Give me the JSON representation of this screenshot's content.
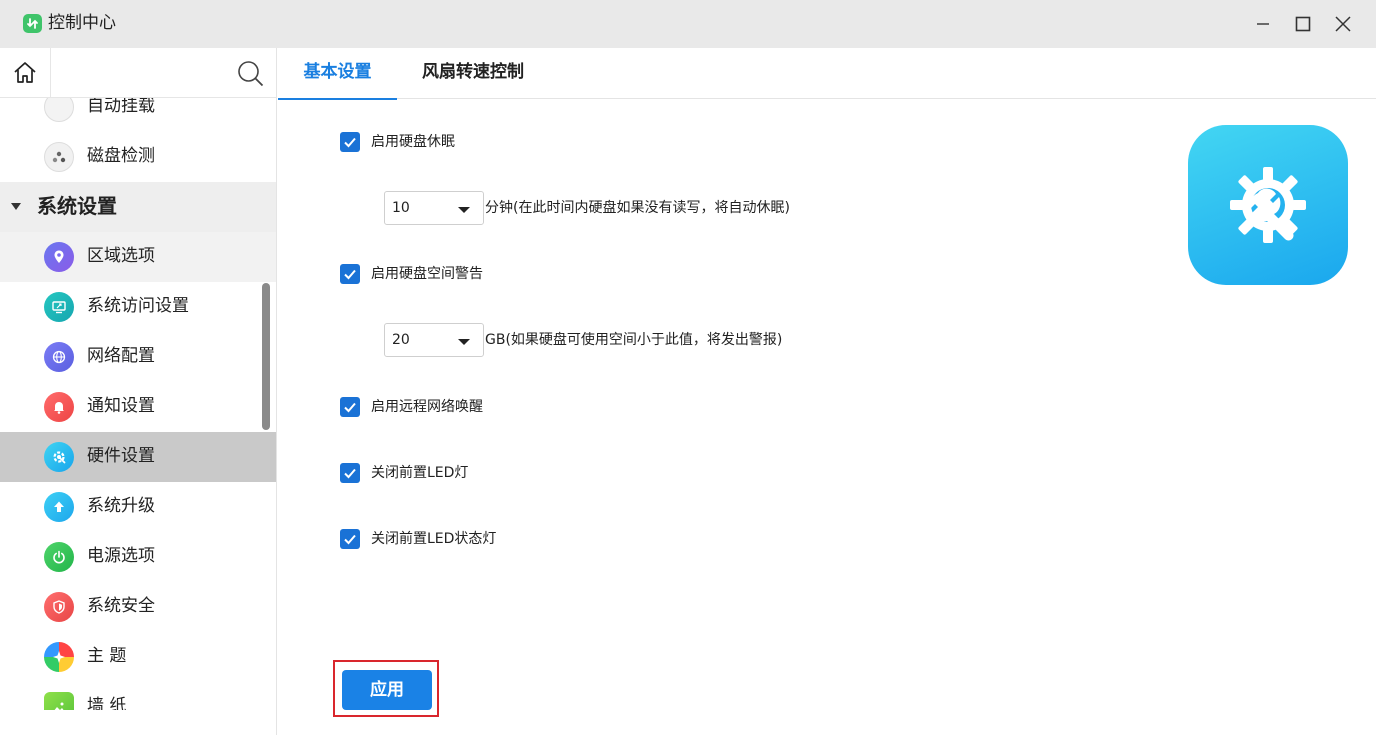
{
  "window": {
    "title": "控制中心"
  },
  "colors": {
    "accent": "#1a7fe0",
    "apply_highlight": "#d9262d",
    "active_item_bg": "#c9c9c9"
  },
  "sidebar": {
    "partial_top_item": "自动挂载",
    "disk_check": "磁盘检测",
    "group": "系统设置",
    "items": [
      {
        "label": "区域选项",
        "icon": "location-pin-icon"
      },
      {
        "label": "系统访问设置",
        "icon": "monitor-access-icon"
      },
      {
        "label": "网络配置",
        "icon": "network-globe-icon"
      },
      {
        "label": "通知设置",
        "icon": "bell-icon"
      },
      {
        "label": "硬件设置",
        "icon": "hardware-gear-icon"
      },
      {
        "label": "系统升级",
        "icon": "upgrade-arrow-icon"
      },
      {
        "label": "电源选项",
        "icon": "power-icon"
      },
      {
        "label": "系统安全",
        "icon": "shield-icon"
      },
      {
        "label": "主 题",
        "icon": "theme-pinwheel-icon"
      },
      {
        "label": "墙 纸",
        "icon": "wallpaper-icon"
      }
    ],
    "active": "硬件设置"
  },
  "tabs": [
    {
      "label": "基本设置",
      "active": true
    },
    {
      "label": "风扇转速控制",
      "active": false
    }
  ],
  "settings": {
    "hdd_sleep": {
      "label": "启用硬盘休眠",
      "checked": true
    },
    "sleep_minutes": {
      "value": "10",
      "desc": "分钟(在此时间内硬盘如果没有读写，将自动休眠)"
    },
    "space_warning": {
      "label": "启用硬盘空间警告",
      "checked": true
    },
    "space_gb": {
      "value": "20",
      "desc": "GB(如果硬盘可使用空间小于此值，将发出警报)"
    },
    "wol": {
      "label": "启用远程网络唤醒",
      "checked": true
    },
    "front_led": {
      "label": "关闭前置LED灯",
      "checked": true
    },
    "front_status_led": {
      "label": "关闭前置LED状态灯",
      "checked": true
    }
  },
  "actions": {
    "apply": "应用"
  }
}
